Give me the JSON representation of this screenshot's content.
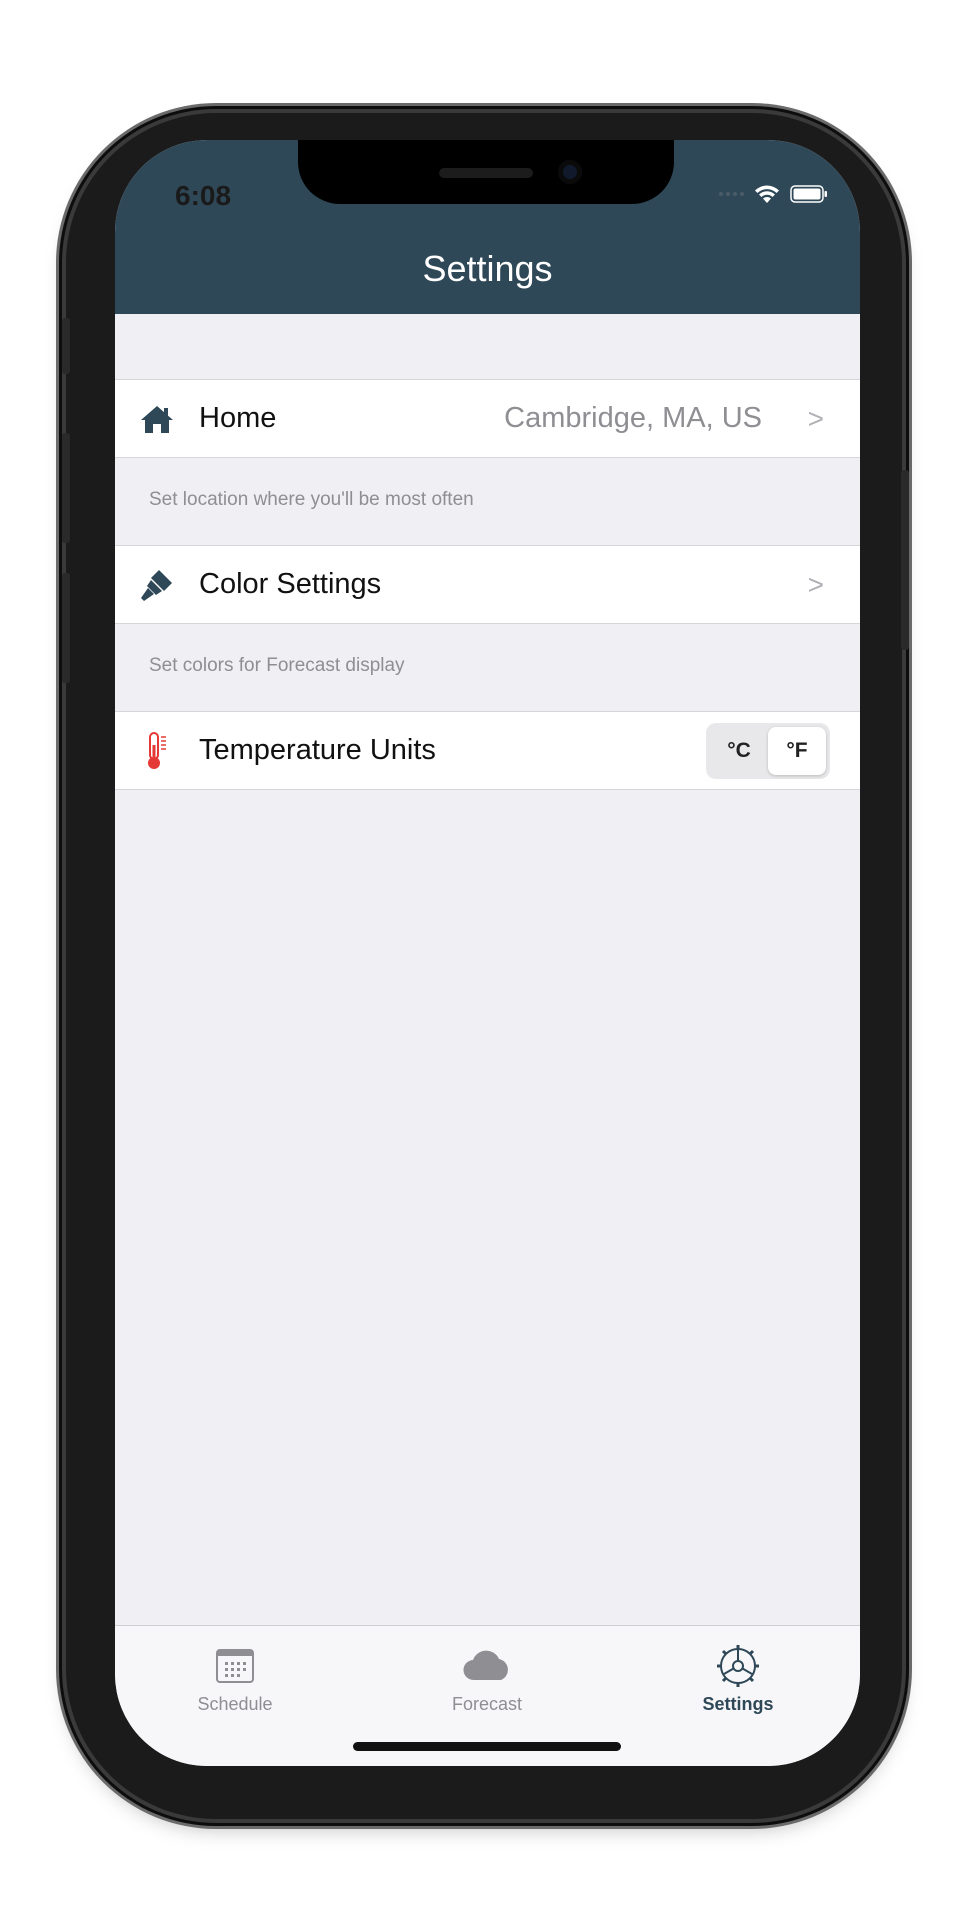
{
  "status_bar": {
    "time": "6:08"
  },
  "navbar": {
    "title": "Settings"
  },
  "rows": {
    "home": {
      "label": "Home",
      "value": "Cambridge, MA, US",
      "icon": "home-icon",
      "footer": "Set location where you'll be most often"
    },
    "color": {
      "label": "Color Settings",
      "icon": "paintbrush-icon",
      "footer": "Set colors for Forecast display"
    },
    "temperature": {
      "label": "Temperature Units",
      "icon": "thermometer-icon",
      "options": [
        "°C",
        "°F"
      ],
      "selected": "°F"
    }
  },
  "tabbar": {
    "tabs": [
      {
        "label": "Schedule",
        "icon": "calendar-icon",
        "active": false
      },
      {
        "label": "Forecast",
        "icon": "cloud-icon",
        "active": false
      },
      {
        "label": "Settings",
        "icon": "gear-icon",
        "active": true
      }
    ]
  },
  "colors": {
    "navbar": "#2f4858",
    "background": "#efeff4",
    "thermometer": "#e53935"
  }
}
